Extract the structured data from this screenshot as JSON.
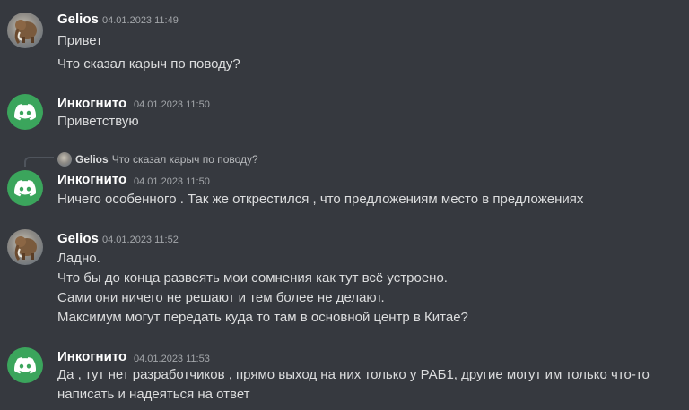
{
  "colors": {
    "background": "#36393f",
    "username": "#ffffff",
    "timestamp": "#a3a6aa",
    "message_text": "#dcddde",
    "discord_green": "#3ba55c"
  },
  "messages": [
    {
      "author": "Gelios",
      "timestamp": "04.01.2023 11:49",
      "avatar_icon": "mammoth-avatar",
      "lines": [
        "Привет",
        "Что сказал карыч по поводу?"
      ]
    },
    {
      "author": "Инкогнито",
      "timestamp": "04.01.2023 11:50",
      "avatar_icon": "discord-logo",
      "lines": [
        "Приветствую"
      ]
    },
    {
      "reply_to": {
        "author": "Gelios",
        "text": "Что сказал карыч по поводу?"
      },
      "author": "Инкогнито",
      "timestamp": "04.01.2023 11:50",
      "avatar_icon": "discord-logo",
      "lines": [
        "Ничего особенного . Так же открестился , что предложениям место в предложениях"
      ]
    },
    {
      "author": "Gelios",
      "timestamp": "04.01.2023 11:52",
      "avatar_icon": "mammoth-avatar",
      "lines": [
        "Ладно.",
        "Что бы до конца развеять мои сомнения как тут всё устроено.",
        "Сами они ничего не решают и тем более не делают.",
        "Максимум могут передать куда то там в основной центр в Китае?"
      ]
    },
    {
      "author": "Инкогнито",
      "timestamp": "04.01.2023 11:53",
      "avatar_icon": "discord-logo",
      "lines": [
        "Да , тут нет разработчиков , прямо выход на них только у РАБ1, другие могут им только что-то",
        "написать и надеяться на ответ"
      ]
    }
  ]
}
